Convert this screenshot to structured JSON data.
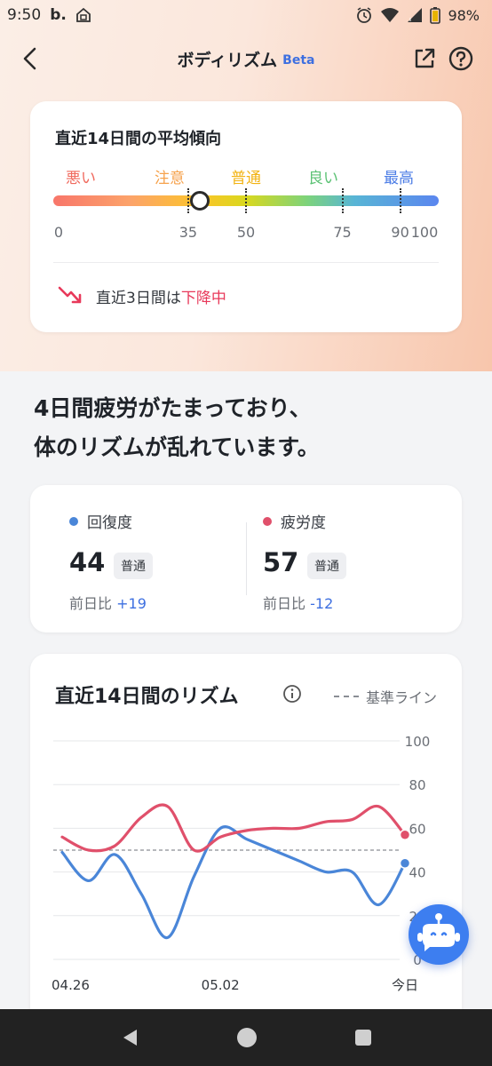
{
  "status_bar": {
    "time": "9:50",
    "app_badge": "b.",
    "battery": "98%"
  },
  "header": {
    "title": "ボディリズム",
    "badge": "Beta",
    "back_icon": "chevron-left-icon",
    "share_icon": "external-share-icon",
    "help_icon": "question-circle-icon"
  },
  "trend_card": {
    "title": "直近14日間の平均傾向",
    "levels": [
      {
        "label": "悪い",
        "color": "#f06a5e"
      },
      {
        "label": "注意",
        "color": "#f6a24c"
      },
      {
        "label": "普通",
        "color": "#f2b313"
      },
      {
        "label": "良い",
        "color": "#5cc275"
      },
      {
        "label": "最高",
        "color": "#4c7de6"
      }
    ],
    "scale": [
      "0",
      "35",
      "50",
      "75",
      "90",
      "100"
    ],
    "average_value": 38,
    "trend_prefix": "直近3日間は",
    "trend_status": "下降中",
    "trend_icon": "trending-down-icon"
  },
  "headline": {
    "line1": "4日間疲労がたまっており、",
    "line2": "体のリズムが乱れています。"
  },
  "scores": {
    "recovery": {
      "label": "回復度",
      "value": "44",
      "badge": "普通",
      "diff_label": "前日比",
      "diff_value": "+19",
      "color": "#4a86d8"
    },
    "fatigue": {
      "label": "疲労度",
      "value": "57",
      "badge": "普通",
      "diff_label": "前日比",
      "diff_value": "-12",
      "color": "#e0506b"
    }
  },
  "rhythm_chart": {
    "title": "直近14日間のリズム",
    "legend_baseline": "基準ライン",
    "info_icon": "info-circle-icon"
  },
  "chart_data": {
    "type": "line",
    "x": [
      1,
      2,
      3,
      4,
      5,
      6,
      7,
      8,
      9,
      10,
      11,
      12,
      13,
      14
    ],
    "x_tick_labels": {
      "1": "04.26",
      "7": "05.02",
      "14": "今日"
    },
    "ylim": [
      0,
      100
    ],
    "yticks": [
      "0",
      "20",
      "40",
      "60",
      "80",
      "100"
    ],
    "baseline": 50,
    "series": [
      {
        "name": "回復度",
        "color": "#4a86d8",
        "values": [
          49,
          36,
          48,
          30,
          10,
          38,
          60,
          55,
          50,
          45,
          40,
          40,
          25,
          44
        ]
      },
      {
        "name": "疲労度",
        "color": "#e0506b",
        "values": [
          56,
          50,
          52,
          65,
          70,
          50,
          56,
          59,
          60,
          60,
          63,
          64,
          70,
          57
        ]
      }
    ],
    "grid": true
  },
  "assistant_fab_icon": "chatbot-icon",
  "nav": {
    "back_icon": "nav-back-icon",
    "home_icon": "nav-home-icon",
    "recents_icon": "nav-recents-icon"
  }
}
